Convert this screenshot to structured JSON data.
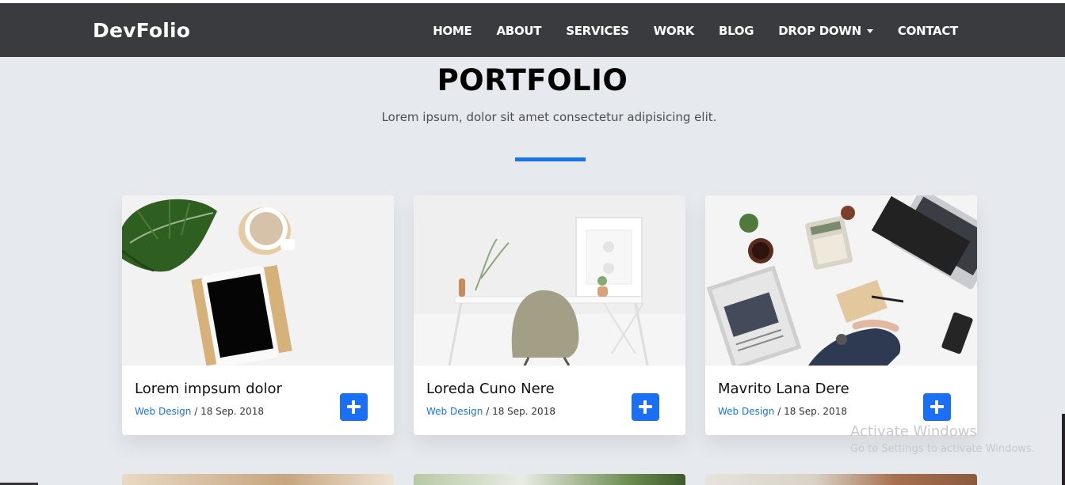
{
  "brand": "DevFolio",
  "nav": {
    "home": "HOME",
    "about": "ABOUT",
    "services": "SERVICES",
    "work": "WORK",
    "blog": "BLOG",
    "dropdown": "DROP DOWN",
    "contact": "CONTACT"
  },
  "portfolio": {
    "title": "PORTFOLIO",
    "subtitle": "Lorem ipsum, dolor sit amet consectetur adipisicing elit.",
    "accent_color": "#1a73e8"
  },
  "cards": [
    {
      "title": "Lorem impsum dolor",
      "category": "Web Design",
      "separator": " / ",
      "date": "18 Sep. 2018"
    },
    {
      "title": "Loreda Cuno Nere",
      "category": "Web Design",
      "separator": " / ",
      "date": "18 Sep. 2018"
    },
    {
      "title": "Mavrito Lana Dere",
      "category": "Web Design",
      "separator": " / ",
      "date": "18 Sep. 2018"
    }
  ],
  "watermark": {
    "line1": "Activate Windows",
    "line2": "Go to Settings to activate Windows."
  },
  "colors": {
    "navbar": "#3a3b3e",
    "page_bg": "#e6e9ed",
    "button": "#1a6ff5"
  }
}
